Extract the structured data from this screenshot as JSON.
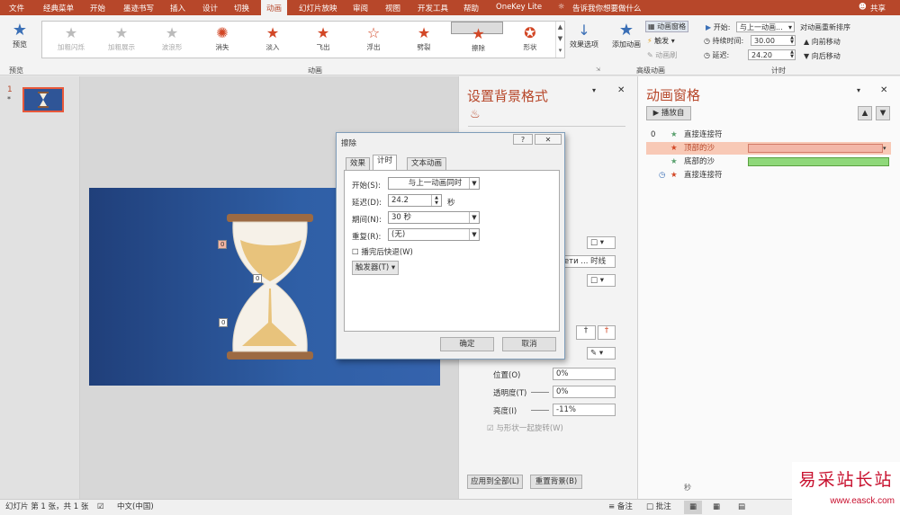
{
  "tabs": [
    "文件",
    "经典菜单",
    "开始",
    "墨迹书写",
    "插入",
    "设计",
    "切换",
    "动画",
    "幻灯片放映",
    "审阅",
    "视图",
    "开发工具",
    "帮助",
    "OneKey Lite"
  ],
  "tell_me": "告诉我你想要做什么",
  "share": "共享",
  "ribbon": {
    "preview": "预览",
    "preview_group": "预览",
    "effects": [
      {
        "label": "加粗闪烁",
        "state": "dim"
      },
      {
        "label": "加粗展示",
        "state": "dim"
      },
      {
        "label": "波浪形",
        "state": "dim"
      },
      {
        "label": "消失",
        "state": "red"
      },
      {
        "label": "淡入",
        "state": "red"
      },
      {
        "label": "飞出",
        "state": "red"
      },
      {
        "label": "浮出",
        "state": "red"
      },
      {
        "label": "劈裂",
        "state": "red"
      },
      {
        "label": "擦除",
        "state": "sel"
      },
      {
        "label": "形状",
        "state": "red"
      }
    ],
    "effect_options": "效果选项",
    "anim_group": "动画",
    "add_anim": "添加动画",
    "anim_pane": "动画窗格",
    "trigger": "触发",
    "anim_brush": "动画刷",
    "adv_group": "高级动画",
    "start_label": "开始:",
    "start_val": "与上一动画...",
    "duration_label": "持续时间:",
    "duration_val": "30.00",
    "delay_label": "延迟:",
    "delay_val": "24.20",
    "reorder": "对动画重新排序",
    "move_earlier": "向前移动",
    "move_later": "向后移动",
    "timing_group": "计时"
  },
  "slide_num": "1",
  "slide_star": "*",
  "tags": [
    "0",
    "0",
    "0"
  ],
  "format_pane": {
    "title": "设置背景格式",
    "line_text": "вдети ... 时线",
    "position_label": "位置(O)",
    "position_val": "0%",
    "transparency_label": "透明度(T)",
    "transparency_val": "0%",
    "brightness_label": "亮度(I)",
    "brightness_val": "-11%",
    "rotate_label": "与形状一起旋转(W)",
    "apply_all": "应用到全部(L)",
    "reset": "重置背景(B)"
  },
  "anim_pane": {
    "title": "动画窗格",
    "play": "播放自",
    "rows": [
      {
        "num": "0",
        "name": "直接连接符",
        "icon": "★",
        "color": "#5aa06e"
      },
      {
        "num": "",
        "name": "顶部的沙",
        "icon": "★",
        "color": "#d24726"
      },
      {
        "num": "",
        "name": "底部的沙",
        "icon": "★",
        "color": "#5aa06e"
      },
      {
        "num": "",
        "name": "直接连接符",
        "icon": "★",
        "color": "#d24726"
      }
    ],
    "footer_sec": "秒"
  },
  "dialog": {
    "title": "擦除",
    "help": "?",
    "close": "✕",
    "tabs": [
      "效果",
      "计时",
      "文本动画"
    ],
    "start_label": "开始(S):",
    "start_val": "与上一动画同时",
    "delay_label": "延迟(D):",
    "delay_val": "24.2",
    "delay_unit": "秒",
    "period_label": "期间(N):",
    "period_val": "30 秒",
    "repeat_label": "重复(R):",
    "repeat_val": "(无)",
    "rewind_label": "播完后快退(W)",
    "trigger": "触发器(T)",
    "ok": "确定",
    "cancel": "取消"
  },
  "status": {
    "slide_info": "幻灯片 第 1 张，共 1 张",
    "lang": "中文(中国)",
    "notes": "备注",
    "comments": "批注"
  },
  "watermark": {
    "title": "易采站长站",
    "url": "www.easck.com"
  }
}
